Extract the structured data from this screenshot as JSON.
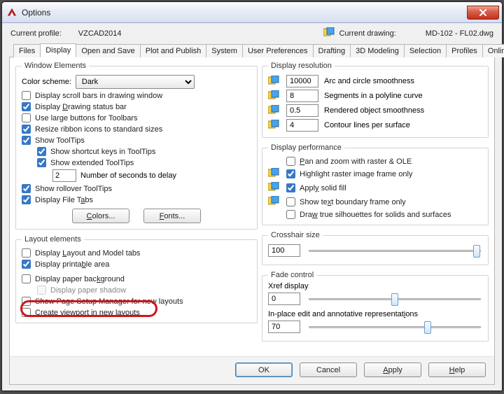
{
  "window": {
    "title": "Options"
  },
  "profile": {
    "profile_label": "Current profile:",
    "profile_value": "VZCAD2014",
    "drawing_label": "Current drawing:",
    "drawing_value": "MD-102 - FL02.dwg"
  },
  "tabs": [
    "Files",
    "Display",
    "Open and Save",
    "Plot and Publish",
    "System",
    "User Preferences",
    "Drafting",
    "3D Modeling",
    "Selection",
    "Profiles",
    "Online"
  ],
  "active_tab_index": 1,
  "window_elements": {
    "legend": "Window Elements",
    "color_scheme_label": "Color scheme:",
    "color_scheme_value": "Dark",
    "scroll_bars": {
      "label": "Display scroll bars in drawing window",
      "checked": false
    },
    "status_bar": {
      "label": "Display Drawing status bar",
      "checked": true,
      "ul": "D"
    },
    "large_buttons": {
      "label": "Use large buttons for Toolbars",
      "checked": false
    },
    "resize_ribbon": {
      "label": "Resize ribbon icons to standard sizes",
      "checked": true
    },
    "show_tooltips": {
      "label": "Show ToolTips",
      "checked": true
    },
    "shortcut_keys": {
      "label": "Show shortcut keys in ToolTips",
      "checked": true
    },
    "extended_tooltips": {
      "label": "Show extended ToolTips",
      "checked": true
    },
    "delay_value": "2",
    "delay_label": "Number of seconds to delay",
    "rollover": {
      "label": "Show rollover ToolTips",
      "checked": true
    },
    "filetabs": {
      "label": "Display File Tabs",
      "checked": true,
      "ul": "a"
    },
    "colors_btn": "Colors...",
    "fonts_btn": "Fonts..."
  },
  "layout_elements": {
    "legend": "Layout elements",
    "layout_model": {
      "label": "Display Layout and Model tabs",
      "checked": false,
      "ul": "L"
    },
    "printable_area": {
      "label": "Display printable area",
      "checked": true,
      "ul": "b"
    },
    "paper_bg": {
      "label": "Display paper background",
      "checked": false,
      "ul": "k"
    },
    "paper_shadow": {
      "label": "Display paper shadow",
      "checked": false,
      "disabled": true
    },
    "page_setup": {
      "label": "Show Page Setup Manager for new layouts",
      "checked": false,
      "ul": "g"
    },
    "create_viewport": {
      "label": "Create viewport in new layouts",
      "checked": false,
      "ul": "n"
    }
  },
  "display_resolution": {
    "legend": "Display resolution",
    "arc": {
      "value": "10000",
      "label": "Arc and circle smoothness"
    },
    "segments": {
      "value": "8",
      "label": "Segments in a polyline curve"
    },
    "rendered": {
      "value": "0.5",
      "label": "Rendered object smoothness"
    },
    "contour": {
      "value": "4",
      "label": "Contour lines per surface"
    }
  },
  "display_performance": {
    "legend": "Display performance",
    "pan_zoom": {
      "label": "Pan and zoom with raster & OLE",
      "checked": false
    },
    "highlight_raster": {
      "label": "Highlight raster image frame only",
      "checked": true
    },
    "solid_fill": {
      "label": "Apply solid fill",
      "checked": true
    },
    "text_boundary": {
      "label": "Show text boundary frame only",
      "checked": false,
      "ul": "x"
    },
    "true_silhouettes": {
      "label": "Draw true silhouettes for solids and surfaces",
      "checked": false,
      "ul": "w"
    }
  },
  "crosshair": {
    "legend": "Crosshair size",
    "value": "100",
    "slider": 100
  },
  "fade": {
    "legend": "Fade control",
    "xref_label": "Xref display",
    "xref_value": "0",
    "xref_slider": 50,
    "inplace_label": "In-place edit and annotative representations",
    "inplace_value": "70",
    "inplace_slider": 70
  },
  "buttons": {
    "ok": "OK",
    "cancel": "Cancel",
    "apply": "Apply",
    "help": "Help"
  }
}
